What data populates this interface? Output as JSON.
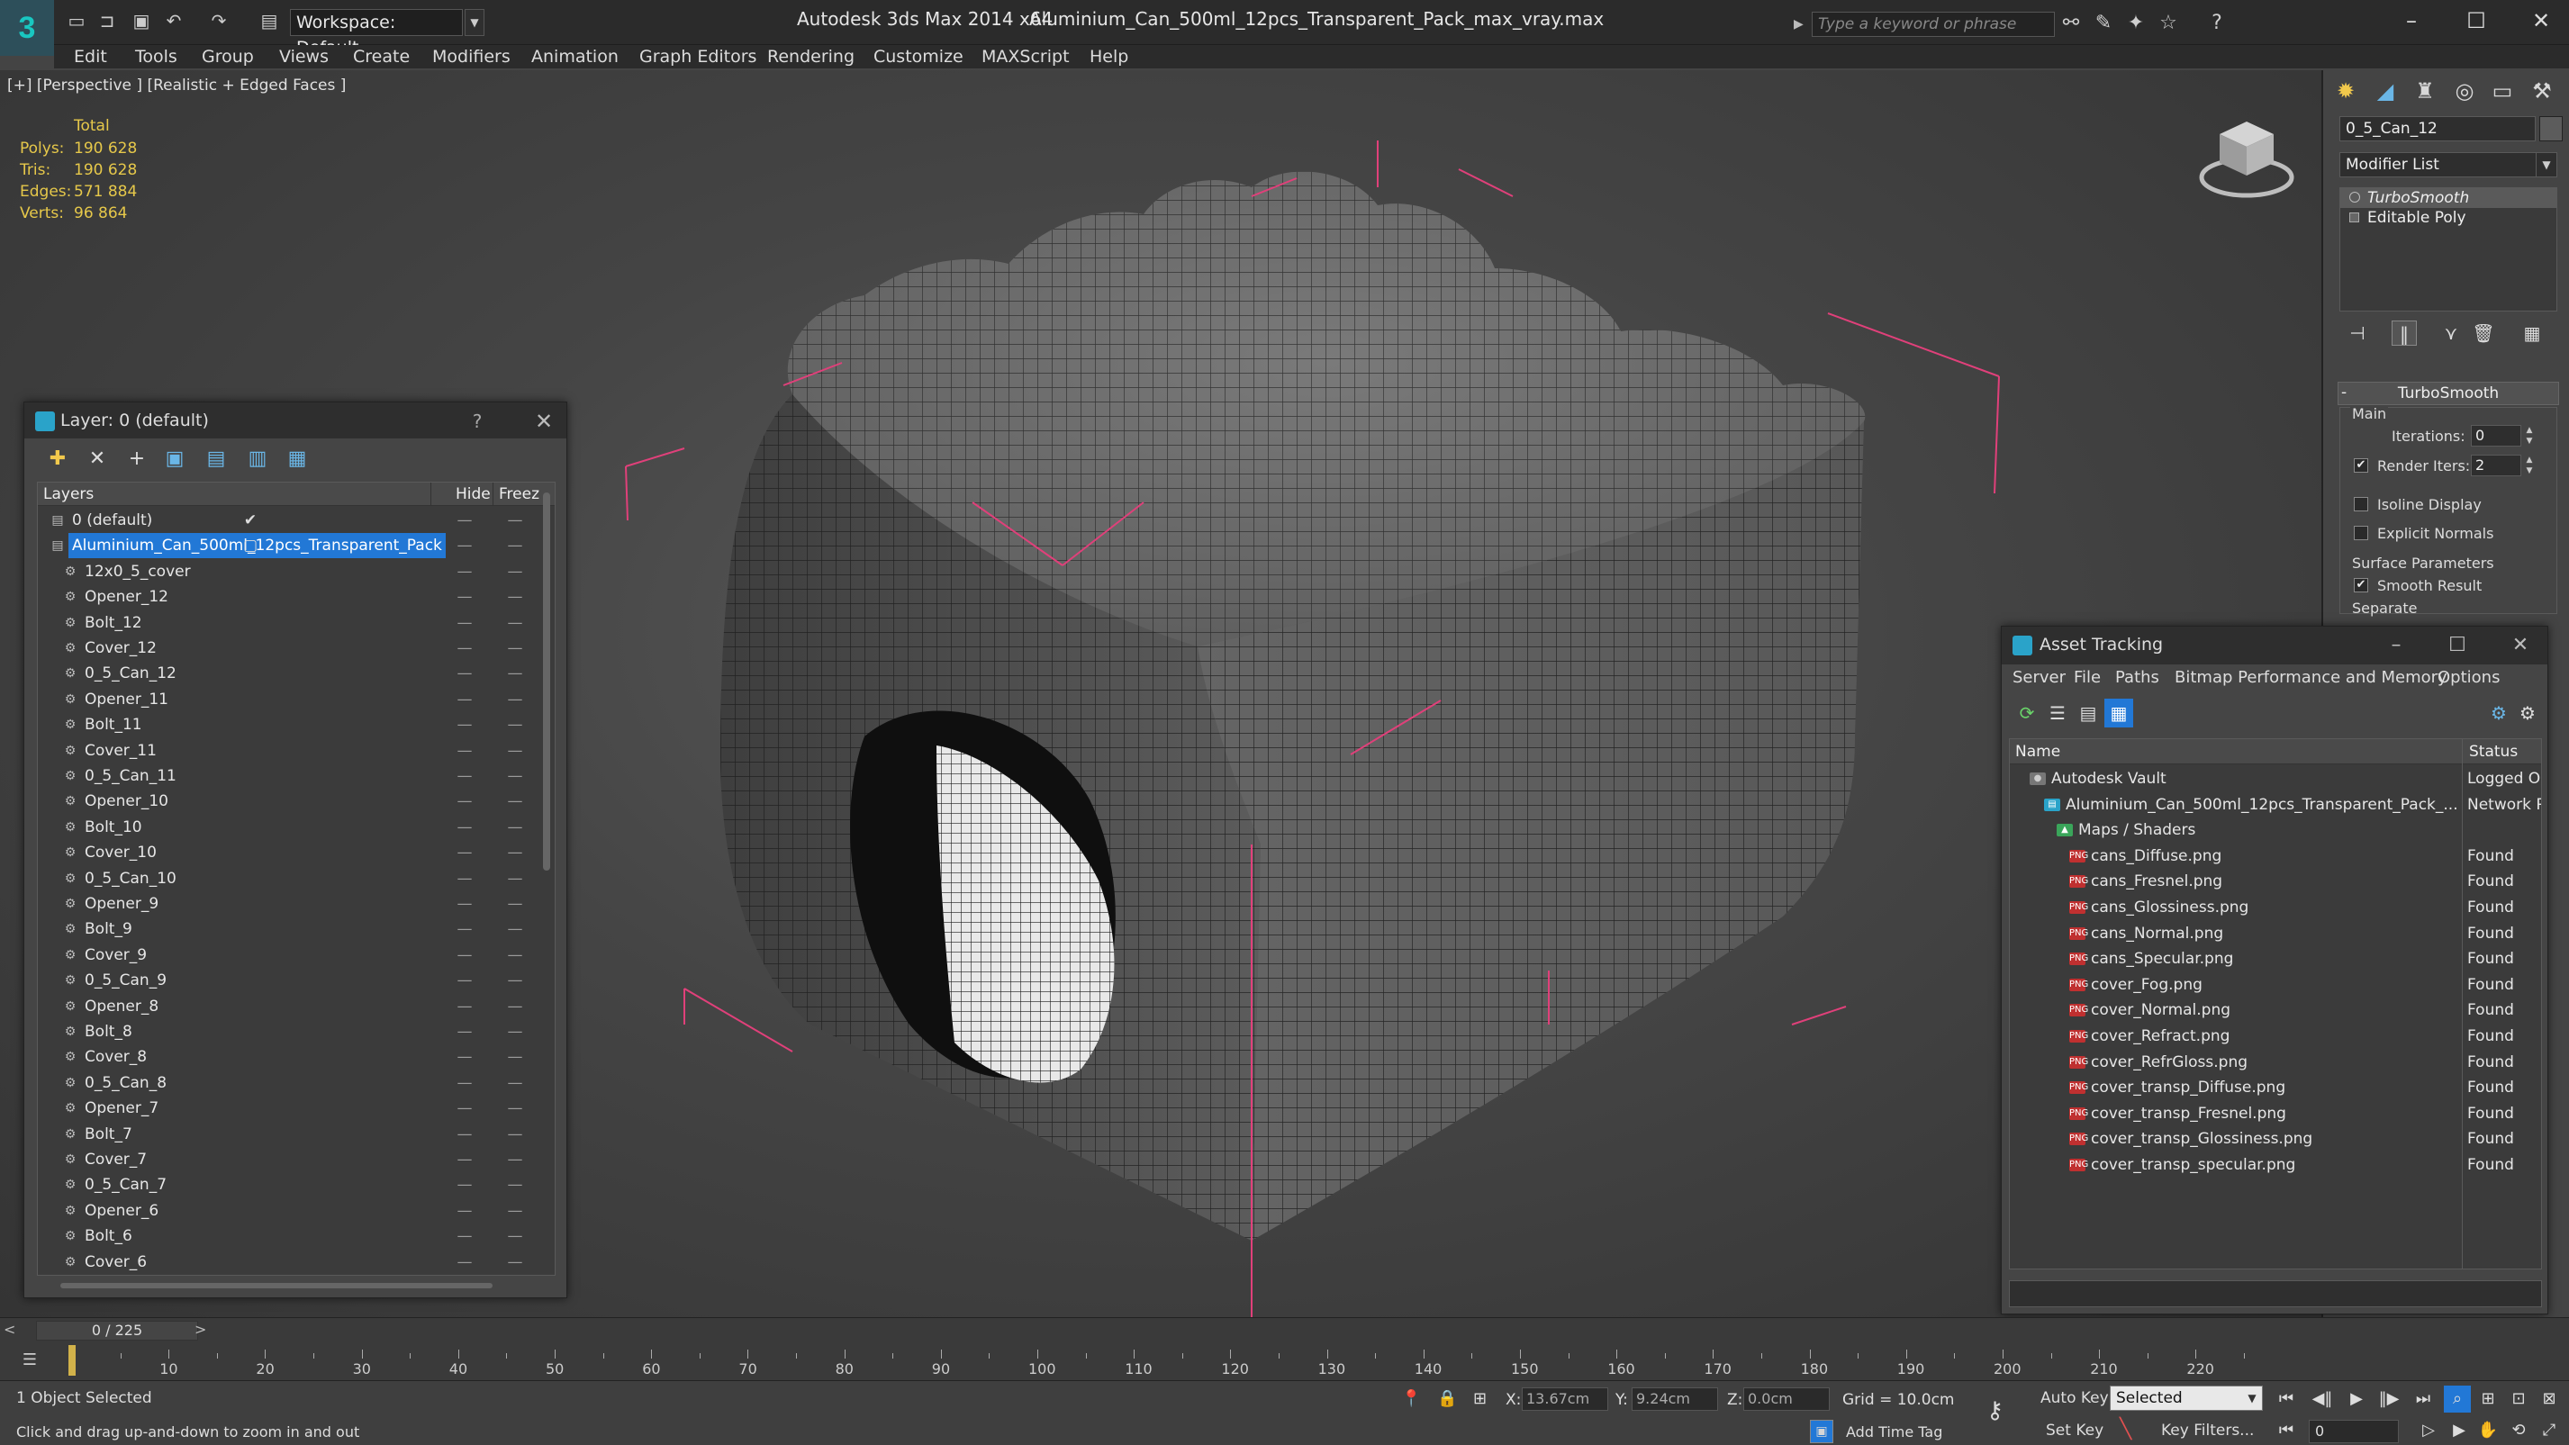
{
  "titlebar": {
    "workspace": "Workspace: Default",
    "app_title": "Autodesk 3ds Max  2014 x64",
    "file_title": "Aluminium_Can_500ml_12pcs_Transparent_Pack_max_vray.max",
    "search_placeholder": "Type a keyword or phrase"
  },
  "menu": [
    "Edit",
    "Tools",
    "Group",
    "Views",
    "Create",
    "Modifiers",
    "Animation",
    "Graph Editors",
    "Rendering",
    "Customize",
    "MAXScript",
    "Help"
  ],
  "viewport": {
    "label": "[+] [Perspective ] [Realistic + Edged Faces ]",
    "stats": {
      "header": "Total",
      "rows": [
        {
          "k": "Polys:",
          "v": "190 628"
        },
        {
          "k": "Tris:",
          "v": "190 628"
        },
        {
          "k": "Edges:",
          "v": "571 884"
        },
        {
          "k": "Verts:",
          "v": "96 864"
        }
      ]
    }
  },
  "command_panel": {
    "object_name": "0_5_Can_12",
    "modifier_list": "Modifier List",
    "stack": [
      {
        "label": "TurboSmooth",
        "selected": true
      },
      {
        "label": "Editable Poly",
        "selected": false
      }
    ],
    "rollout_title": "TurboSmooth",
    "main_label": "Main",
    "iterations_label": "Iterations:",
    "iterations_value": "0",
    "render_iters_label": "Render Iters:",
    "render_iters_value": "2",
    "isoline_label": "Isoline Display",
    "explicit_normals_label": "Explicit Normals",
    "surface_params_label": "Surface Parameters",
    "smooth_result_label": "Smooth Result",
    "separate_label": "Separate"
  },
  "layer_dialog": {
    "title": "Layer: 0 (default)",
    "help": "?",
    "col_layers": "Layers",
    "col_hide": "Hide",
    "col_freeze": "Freez",
    "rows": [
      {
        "name": "0 (default)",
        "level": 0,
        "check": "✔"
      },
      {
        "name": "Aluminium_Can_500ml_12pcs_Transparent_Pack",
        "level": 0,
        "selected": true
      },
      {
        "name": "12x0_5_cover",
        "level": 1
      },
      {
        "name": "Opener_12",
        "level": 1
      },
      {
        "name": "Bolt_12",
        "level": 1
      },
      {
        "name": "Cover_12",
        "level": 1
      },
      {
        "name": "0_5_Can_12",
        "level": 1
      },
      {
        "name": "Opener_11",
        "level": 1
      },
      {
        "name": "Bolt_11",
        "level": 1
      },
      {
        "name": "Cover_11",
        "level": 1
      },
      {
        "name": "0_5_Can_11",
        "level": 1
      },
      {
        "name": "Opener_10",
        "level": 1
      },
      {
        "name": "Bolt_10",
        "level": 1
      },
      {
        "name": "Cover_10",
        "level": 1
      },
      {
        "name": "0_5_Can_10",
        "level": 1
      },
      {
        "name": "Opener_9",
        "level": 1
      },
      {
        "name": "Bolt_9",
        "level": 1
      },
      {
        "name": "Cover_9",
        "level": 1
      },
      {
        "name": "0_5_Can_9",
        "level": 1
      },
      {
        "name": "Opener_8",
        "level": 1
      },
      {
        "name": "Bolt_8",
        "level": 1
      },
      {
        "name": "Cover_8",
        "level": 1
      },
      {
        "name": "0_5_Can_8",
        "level": 1
      },
      {
        "name": "Opener_7",
        "level": 1
      },
      {
        "name": "Bolt_7",
        "level": 1
      },
      {
        "name": "Cover_7",
        "level": 1
      },
      {
        "name": "0_5_Can_7",
        "level": 1
      },
      {
        "name": "Opener_6",
        "level": 1
      },
      {
        "name": "Bolt_6",
        "level": 1
      },
      {
        "name": "Cover_6",
        "level": 1
      }
    ]
  },
  "asset_dialog": {
    "title": "Asset Tracking",
    "menu": [
      "Server",
      "File",
      "Paths",
      "Bitmap Performance and Memory",
      "Options"
    ],
    "col_name": "Name",
    "col_status": "Status",
    "rows": [
      {
        "name": "Autodesk Vault",
        "status": "Logged Ou",
        "level": 1,
        "icon": "vault"
      },
      {
        "name": "Aluminium_Can_500ml_12pcs_Transparent_Pack_...",
        "status": "Network P.",
        "level": 2,
        "icon": "file"
      },
      {
        "name": "Maps / Shaders",
        "status": "",
        "level": 3,
        "icon": "maps"
      },
      {
        "name": "cans_Diffuse.png",
        "status": "Found",
        "level": 4,
        "icon": "png"
      },
      {
        "name": "cans_Fresnel.png",
        "status": "Found",
        "level": 4,
        "icon": "png"
      },
      {
        "name": "cans_Glossiness.png",
        "status": "Found",
        "level": 4,
        "icon": "png"
      },
      {
        "name": "cans_Normal.png",
        "status": "Found",
        "level": 4,
        "icon": "png"
      },
      {
        "name": "cans_Specular.png",
        "status": "Found",
        "level": 4,
        "icon": "png"
      },
      {
        "name": "cover_Fog.png",
        "status": "Found",
        "level": 4,
        "icon": "png"
      },
      {
        "name": "cover_Normal.png",
        "status": "Found",
        "level": 4,
        "icon": "png"
      },
      {
        "name": "cover_Refract.png",
        "status": "Found",
        "level": 4,
        "icon": "png"
      },
      {
        "name": "cover_RefrGloss.png",
        "status": "Found",
        "level": 4,
        "icon": "png"
      },
      {
        "name": "cover_transp_Diffuse.png",
        "status": "Found",
        "level": 4,
        "icon": "png"
      },
      {
        "name": "cover_transp_Fresnel.png",
        "status": "Found",
        "level": 4,
        "icon": "png"
      },
      {
        "name": "cover_transp_Glossiness.png",
        "status": "Found",
        "level": 4,
        "icon": "png"
      },
      {
        "name": "cover_transp_specular.png",
        "status": "Found",
        "level": 4,
        "icon": "png"
      }
    ]
  },
  "timeline": {
    "frame": "0 / 225",
    "left_arrow": "<",
    "right_arrow": ">",
    "ticks": [
      10,
      20,
      30,
      40,
      50,
      60,
      70,
      80,
      90,
      100,
      110,
      120,
      130,
      140,
      150,
      160,
      170,
      180,
      190,
      200,
      210,
      220
    ]
  },
  "status": {
    "selection": "1 Object Selected",
    "prompt": "Click and drag up-and-down to zoom in and out",
    "x_label": "X:",
    "x_value": "13.67cm",
    "y_label": "Y:",
    "y_value": "9.24cm",
    "z_label": "Z:",
    "z_value": "0.0cm",
    "grid": "Grid = 10.0cm",
    "auto_key": "Auto Key",
    "set_key": "Set Key",
    "selected": "Selected",
    "key_filters": "Key Filters...",
    "add_time_tag": "Add Time Tag",
    "frame_value": "0"
  },
  "colors": {
    "accent": "#2278d6",
    "stats": "#e6c84a",
    "selection_box": "#e0407a",
    "logo": "#19c7c1"
  }
}
